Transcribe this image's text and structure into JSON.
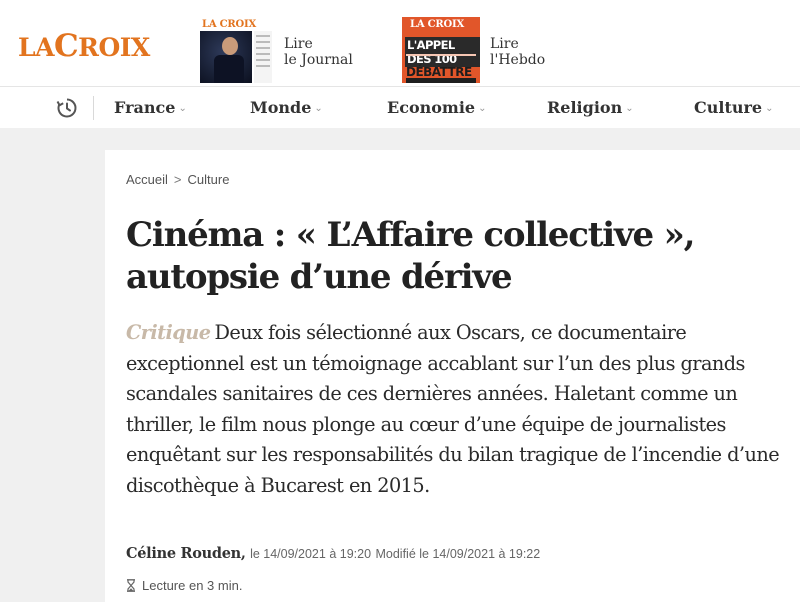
{
  "brand": {
    "logo_part1": "LA",
    "logo_part2": "C",
    "logo_part3": "ROIX"
  },
  "papers": {
    "journal": {
      "masthead": "LA CROIX",
      "label_line1": "Lire",
      "label_line2": "le Journal"
    },
    "hebdo": {
      "masthead": "LA CROIX",
      "cover_headline": "L'APPEL DES 100",
      "cover_sub": "DÉBATTRE",
      "label_line1": "Lire",
      "label_line2": "l'Hebdo"
    }
  },
  "nav": {
    "clock_icon": "clock-icon",
    "items": [
      {
        "label": "France",
        "chevron": "⌄"
      },
      {
        "label": "Monde",
        "chevron": "⌄"
      },
      {
        "label": "Economie",
        "chevron": "⌄"
      },
      {
        "label": "Religion",
        "chevron": "⌄"
      },
      {
        "label": "Culture",
        "chevron": "⌄"
      }
    ]
  },
  "article": {
    "breadcrumb": {
      "home": "Accueil",
      "separator": ">",
      "section": "Culture"
    },
    "title_line1": "Cinéma : « L’Affaire collective »,",
    "title_line2": "autopsie d’une dérive",
    "tag": "Critique",
    "chapo": "Deux fois sélectionné aux Oscars, ce documentaire exceptionnel est un témoignage accablant sur l’un des plus grands scandales sanitaires de ces dernières années. Haletant comme un thriller, le film nous plonge au cœur d’une équipe de journalistes enquêtant sur les responsabilités du bilan tragique de l’incendie d’une discothèque à Bucarest en 2015.",
    "author": "Céline Rouden,",
    "published": "le 14/09/2021 à 19:20",
    "modified": "Modifié le 14/09/2021 à 19:22",
    "reading_time": "Lecture en 3 min."
  },
  "colors": {
    "brand_orange": "#e2741f",
    "tag_beige": "#c8b9a8",
    "page_bg": "#f0f0f0"
  }
}
